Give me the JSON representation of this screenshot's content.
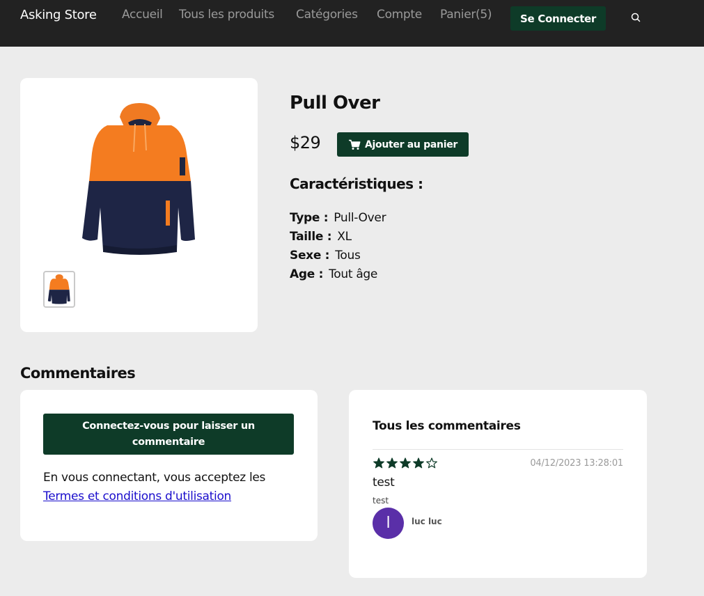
{
  "navbar": {
    "brand": "Asking Store",
    "links": [
      "Accueil",
      "Tous les produits",
      "Catégories",
      "Compte",
      "Panier(5)"
    ],
    "login_label": "Se Connecter"
  },
  "product": {
    "title": "Pull Over",
    "price": "$29",
    "add_to_cart_label": "Ajouter au panier",
    "features_title": "Caractéristiques :",
    "features": [
      {
        "label": "Type :",
        "value": "Pull-Over"
      },
      {
        "label": "Taille :",
        "value": "XL"
      },
      {
        "label": "Sexe :",
        "value": "Tous"
      },
      {
        "label": "Age :",
        "value": "Tout âge"
      }
    ]
  },
  "comments": {
    "section_title": "Commentaires",
    "login_prompt_label": "Connectez-vous pour laisser un commentaire",
    "consent_text": "En vous connectant, vous acceptez les",
    "terms_link_label": "Termes et conditions d'utilisation",
    "list_title": "Tous les commentaires",
    "items": [
      {
        "rating": 4,
        "rating_max": 5,
        "date": "04/12/2023 13:28:01",
        "title": "test",
        "body": "test",
        "avatar_initial": "l",
        "user": "luc luc"
      }
    ]
  },
  "colors": {
    "navbar": "#222222",
    "accent": "#0e3b28",
    "background": "#ececec",
    "avatar": "#5a2fa8",
    "link": "#1a0dcc"
  },
  "icons": [
    "search-icon",
    "cart-icon",
    "star-icon"
  ]
}
